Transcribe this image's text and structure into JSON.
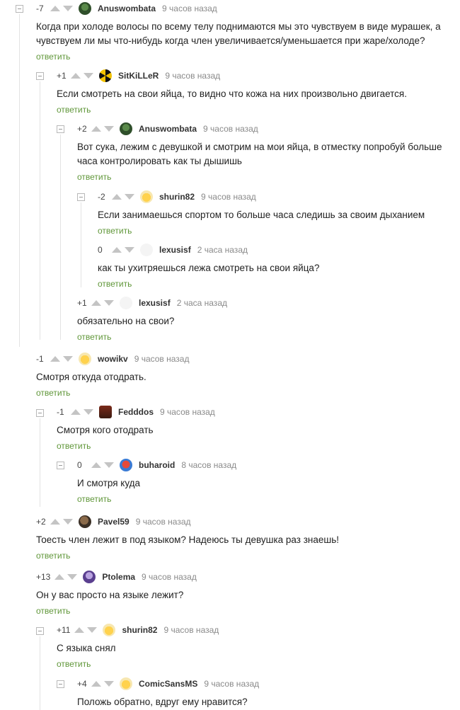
{
  "colors": {
    "accent_reply": "#5f9638",
    "arrow": "#c4c4c4",
    "thread_line": "#e3e3e3"
  },
  "comments": [
    {
      "rating": "-7",
      "author": "Anuswombata",
      "time": "9 часов назад",
      "avatar": "green-face-avatar",
      "text": "Когда при холоде волосы по всему телу поднимаются мы это чувствуем в виде мурашек, а чувствуем ли мы что-нибудь когда член увеличивается/уменьшается при жаре/холоде?",
      "reply": "ответить"
    },
    {
      "rating": "+1",
      "author": "SitKiLLeR",
      "time": "9 часов назад",
      "avatar": "radiation-avatar",
      "text": "Если смотреть на свои яйца, то видно что кожа на них произвольно двигается.",
      "reply": "ответить"
    },
    {
      "rating": "+2",
      "author": "Anuswombata",
      "time": "9 часов назад",
      "avatar": "green-face-avatar",
      "text": "Вот сука, лежим с девушкой и смотрим на мои яйца, в отместку попробуй больше часа контролировать как ты дышишь",
      "reply": "ответить"
    },
    {
      "rating": "-2",
      "author": "shurin82",
      "time": "9 часов назад",
      "avatar": "emoji-avatar",
      "text": "Если занимаешься спортом то больше часа следишь за своим дыханием",
      "reply": "ответить"
    },
    {
      "rating": "0",
      "author": "lexusisf",
      "time": "2 часа назад",
      "avatar": "blank-avatar",
      "text": "как ты ухитряешься лежа смотреть на свои яйца?",
      "reply": "ответить"
    },
    {
      "rating": "+1",
      "author": "lexusisf",
      "time": "2 часа назад",
      "avatar": "blank-avatar",
      "text": "обязательно на свои?",
      "reply": "ответить"
    },
    {
      "rating": "-1",
      "author": "wowikv",
      "time": "9 часов назад",
      "avatar": "emoji-avatar",
      "text": "Смотря откуда отодрать.",
      "reply": "ответить"
    },
    {
      "rating": "-1",
      "author": "Fedddos",
      "time": "9 часов назад",
      "avatar": "dark-avatar",
      "text": "Смотря кого отодрать",
      "reply": "ответить"
    },
    {
      "rating": "0",
      "author": "buharoid",
      "time": "8 часов назад",
      "avatar": "colorful-avatar",
      "text": "И смотря куда",
      "reply": "ответить"
    },
    {
      "rating": "+2",
      "author": "Pavel59",
      "time": "9 часов назад",
      "avatar": "photo-avatar",
      "text": "Тоесть член лежит в под языком? Надеюсь ты девушка раз знаешь!",
      "reply": "ответить"
    },
    {
      "rating": "+13",
      "author": "Ptolema",
      "time": "9 часов назад",
      "avatar": "purple-avatar",
      "text": "Он у вас просто на языке лежит?",
      "reply": "ответить"
    },
    {
      "rating": "+11",
      "author": "shurin82",
      "time": "9 часов назад",
      "avatar": "emoji-avatar",
      "text": "С языка снял",
      "reply": "ответить"
    },
    {
      "rating": "+4",
      "author": "ComicSansMS",
      "time": "9 часов назад",
      "avatar": "emoji-avatar",
      "text": "Положь обратно, вдруг ему нравится?",
      "reply": ""
    }
  ]
}
